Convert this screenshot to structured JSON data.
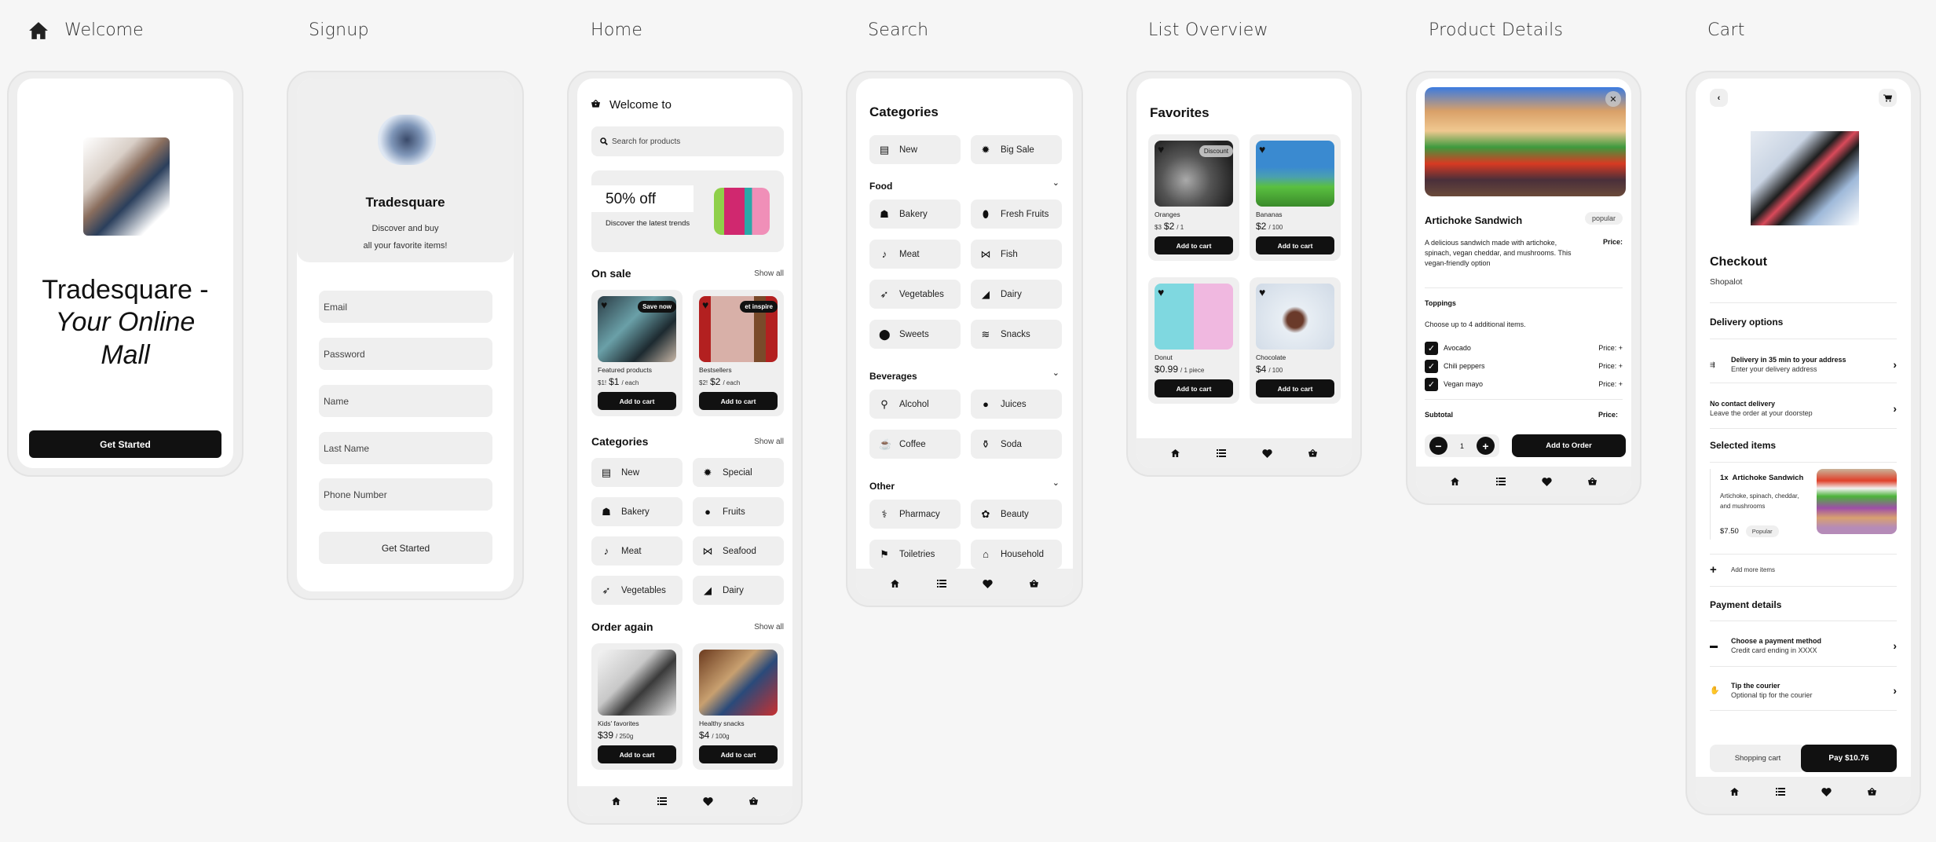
{
  "colors": {
    "accent": "#111111",
    "surface": "#efefef",
    "background": "#f6f6f6"
  },
  "labels": {
    "welcome": "Welcome",
    "signup": "Signup",
    "home": "Home",
    "search": "Search",
    "list": "List Overview",
    "product": "Product Details",
    "cart": "Cart"
  },
  "welcome": {
    "title": "Tradesquare",
    "title_dash": " -",
    "tagline_1": "Your Online",
    "tagline_2": "Mall",
    "cta": "Get Started"
  },
  "signup": {
    "brand": "Tradesquare",
    "subtitle_1": "Discover and buy",
    "subtitle_2": "all your favorite items!",
    "fields": [
      "Email",
      "Password",
      "Name",
      "Last Name",
      "Phone Number"
    ],
    "cta": "Get Started"
  },
  "home": {
    "greeting": "Welcome to",
    "search_placeholder": "Search for products",
    "banner": {
      "headline": "50% off",
      "subtitle": "Discover the latest trends"
    },
    "on_sale": {
      "title": "On sale",
      "show_all": "Show all",
      "items": [
        {
          "name": "Featured products",
          "old_price": "$1!",
          "price": "$1",
          "unit": "/ each",
          "badge": "Save now",
          "button": "Add to cart"
        },
        {
          "name": "Bestsellers",
          "old_price": "$2!",
          "price": "$2",
          "unit": "/ each",
          "badge": "et inspire",
          "button": "Add to cart"
        }
      ]
    },
    "categories": {
      "title": "Categories",
      "show_all": "Show all",
      "items": [
        {
          "label": "New",
          "icon": "store-icon"
        },
        {
          "label": "Special",
          "icon": "badge-icon"
        },
        {
          "label": "Bakery",
          "icon": "bread-icon"
        },
        {
          "label": "Fruits",
          "icon": "apple-icon"
        },
        {
          "label": "Meat",
          "icon": "drumstick-icon"
        },
        {
          "label": "Seafood",
          "icon": "fish-icon"
        },
        {
          "label": "Vegetables",
          "icon": "carrot-icon"
        },
        {
          "label": "Dairy",
          "icon": "cheese-icon"
        }
      ]
    },
    "order_again": {
      "title": "Order again",
      "show_all": "Show all",
      "items": [
        {
          "name": "Kids' favorites",
          "price": "$39",
          "unit": "/ 250g",
          "button": "Add to cart"
        },
        {
          "name": "Healthy snacks",
          "price": "$4",
          "unit": "/ 100g",
          "button": "Add to cart"
        }
      ]
    }
  },
  "search": {
    "title": "Categories",
    "top": [
      {
        "label": "New",
        "icon": "store-icon"
      },
      {
        "label": "Big Sale",
        "icon": "badge-icon"
      }
    ],
    "groups": [
      {
        "title": "Food",
        "items": [
          {
            "label": "Bakery",
            "icon": "bread-icon"
          },
          {
            "label": "Fresh Fruits",
            "icon": "lemon-icon"
          },
          {
            "label": "Meat",
            "icon": "drumstick-icon"
          },
          {
            "label": "Fish",
            "icon": "fish-icon"
          },
          {
            "label": "Vegetables",
            "icon": "carrot-icon"
          },
          {
            "label": "Dairy",
            "icon": "cheese-icon"
          },
          {
            "label": "Sweets",
            "icon": "cookie-icon"
          },
          {
            "label": "Snacks",
            "icon": "bacon-icon"
          }
        ]
      },
      {
        "title": "Beverages",
        "items": [
          {
            "label": "Alcohol",
            "icon": "wine-icon"
          },
          {
            "label": "Juices",
            "icon": "apple-icon"
          },
          {
            "label": "Coffee",
            "icon": "mug-icon"
          },
          {
            "label": "Soda",
            "icon": "bottle-icon"
          }
        ]
      },
      {
        "title": "Other",
        "items": [
          {
            "label": "Pharmacy",
            "icon": "pills-icon"
          },
          {
            "label": "Beauty",
            "icon": "spa-icon"
          },
          {
            "label": "Toiletries",
            "icon": "toilet-icon"
          },
          {
            "label": "Household",
            "icon": "house-icon"
          }
        ]
      }
    ]
  },
  "list": {
    "title": "Favorites",
    "items": [
      {
        "name": "Oranges",
        "old_price": "$3",
        "price": "$2",
        "unit": "/ 1",
        "badge": "Discount",
        "button": "Add to cart"
      },
      {
        "name": "Bananas",
        "price": "$2",
        "unit": "/ 100",
        "button": "Add to cart"
      },
      {
        "name": "Donut",
        "price": "$0.99",
        "unit": "/ 1 piece",
        "button": "Add to cart"
      },
      {
        "name": "Chocolate",
        "price": "$4",
        "unit": "/ 100",
        "button": "Add to cart"
      }
    ]
  },
  "product": {
    "name": "Artichoke Sandwich",
    "tag": "popular",
    "description": "A delicious sandwich made with artichoke, spinach, vegan cheddar, and mushrooms. This vegan-friendly option",
    "price_label": "Price:",
    "toppings_title": "Toppings",
    "toppings_hint": "Choose up to 4 additional items.",
    "toppings": [
      {
        "label": "Avocado",
        "price": "Price: +",
        "checked": true
      },
      {
        "label": "Chili peppers",
        "price": "Price: +",
        "checked": true
      },
      {
        "label": "Vegan mayo",
        "price": "Price: +",
        "checked": true
      }
    ],
    "subtotal_label": "Subtotal",
    "subtotal_price": "Price:",
    "quantity": "1",
    "cta": "Add to Order"
  },
  "cart": {
    "title": "Checkout",
    "store": "Shopalot",
    "delivery_title": "Delivery options",
    "delivery": [
      {
        "title": "Delivery in 35 min to your address",
        "subtitle": "Enter your delivery address"
      },
      {
        "title": "No contact delivery",
        "subtitle": "Leave the order at your doorstep"
      }
    ],
    "selected_title": "Selected items",
    "item": {
      "qty": "1x",
      "name": "Artichoke Sandwich",
      "desc_1": "Artichoke, spinach, cheddar,",
      "desc_2": "and mushrooms",
      "price": "$7.50",
      "tag": "Popular"
    },
    "add_more": "Add more items",
    "payment_title": "Payment details",
    "payment": [
      {
        "title": "Choose a payment method",
        "subtitle": "Credit card ending in XXXX"
      },
      {
        "title": "Tip the courier",
        "subtitle": "Optional tip for the courier"
      }
    ],
    "secondary": "Shopping cart",
    "pay": "Pay $10.76"
  }
}
